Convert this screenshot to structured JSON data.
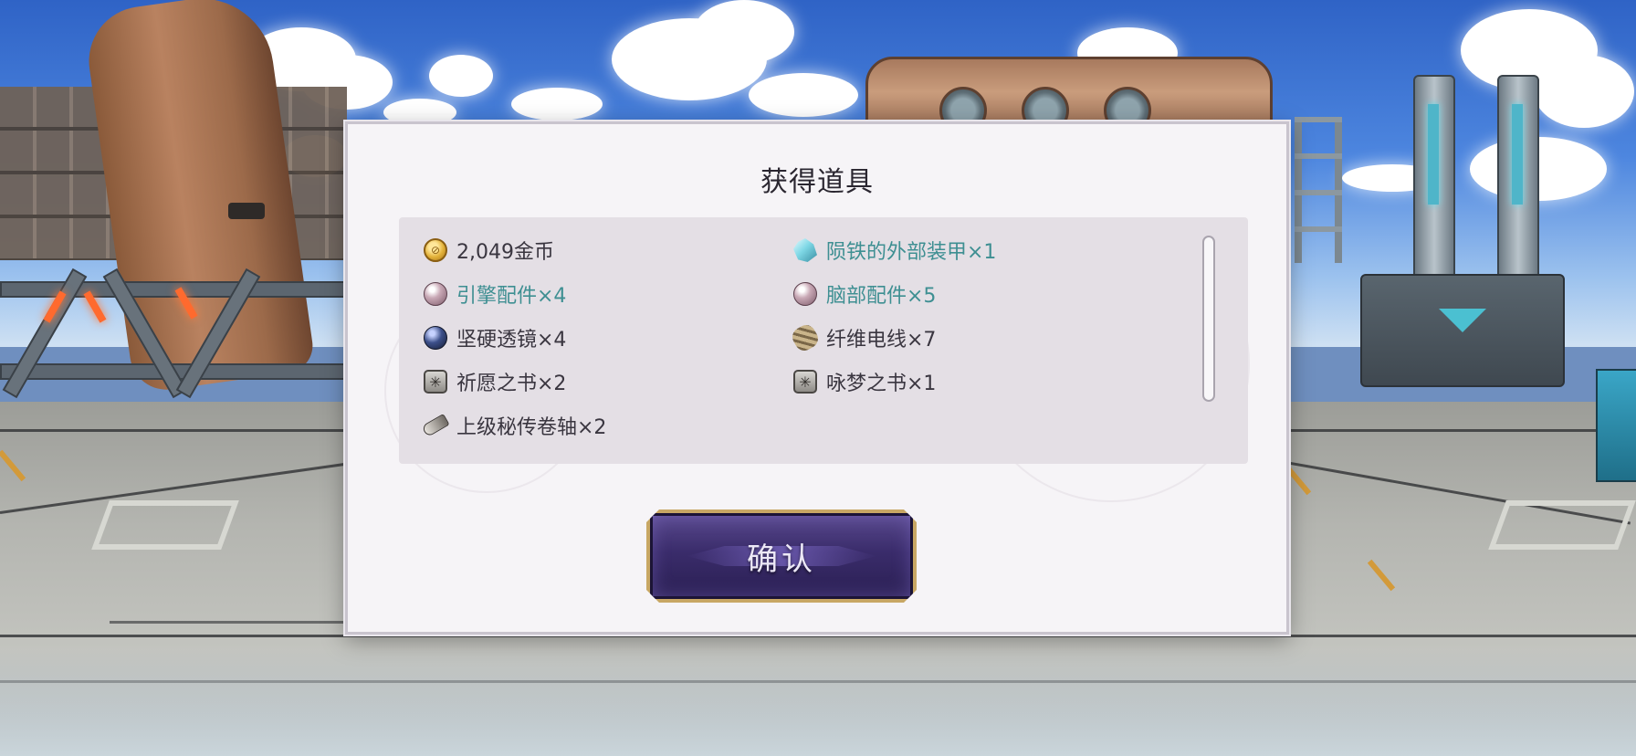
{
  "dialog": {
    "title": "获得道具",
    "items": [
      {
        "icon": "gold-coin-icon",
        "label": "2,049金币",
        "highlight": false
      },
      {
        "icon": "crystal-ore-icon",
        "label": "陨铁的外部装甲×1",
        "highlight": true
      },
      {
        "icon": "pearl-orb-icon",
        "label": "引擎配件×4",
        "highlight": true
      },
      {
        "icon": "pearl-orb-icon",
        "label": "脑部配件×5",
        "highlight": true
      },
      {
        "icon": "dark-orb-icon",
        "label": "坚硬透镜×4",
        "highlight": false
      },
      {
        "icon": "fiber-wire-icon",
        "label": "纤维电线×7",
        "highlight": false
      },
      {
        "icon": "book-icon",
        "label": "祈愿之书×2",
        "highlight": false
      },
      {
        "icon": "book-icon",
        "label": "咏梦之书×1",
        "highlight": false
      },
      {
        "icon": "scroll-icon",
        "label": "上级秘传卷轴×2",
        "highlight": false
      }
    ],
    "confirm_label": "确认"
  },
  "colors": {
    "highlight_text": "#3e8f92",
    "normal_text": "#3a3640",
    "button_gold": "#c8a764",
    "button_purple": "#3a2c6b"
  }
}
